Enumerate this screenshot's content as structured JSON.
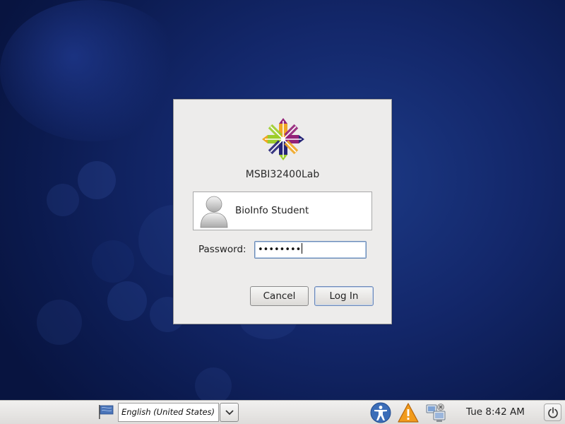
{
  "login": {
    "hostname": "MSBI32400Lab",
    "user_name": "BioInfo Student",
    "password_label": "Password:",
    "password_value": "••••••••",
    "cancel_label": "Cancel",
    "login_label": "Log In"
  },
  "panel": {
    "language": "English (United States)",
    "clock": "Tue  8:42 AM"
  },
  "icons": {
    "logo": "centos-logo-icon",
    "avatar": "user-avatar-icon",
    "flag": "keyboard-layout-flag-icon",
    "dropdown": "chevron-down-icon",
    "accessibility": "accessibility-icon",
    "warning": "warning-icon",
    "network": "network-icon",
    "power": "power-icon"
  },
  "colors": {
    "desktop_background": "#13276a",
    "dialog_background": "#edeceb",
    "focus_border": "#6a8ab5"
  }
}
